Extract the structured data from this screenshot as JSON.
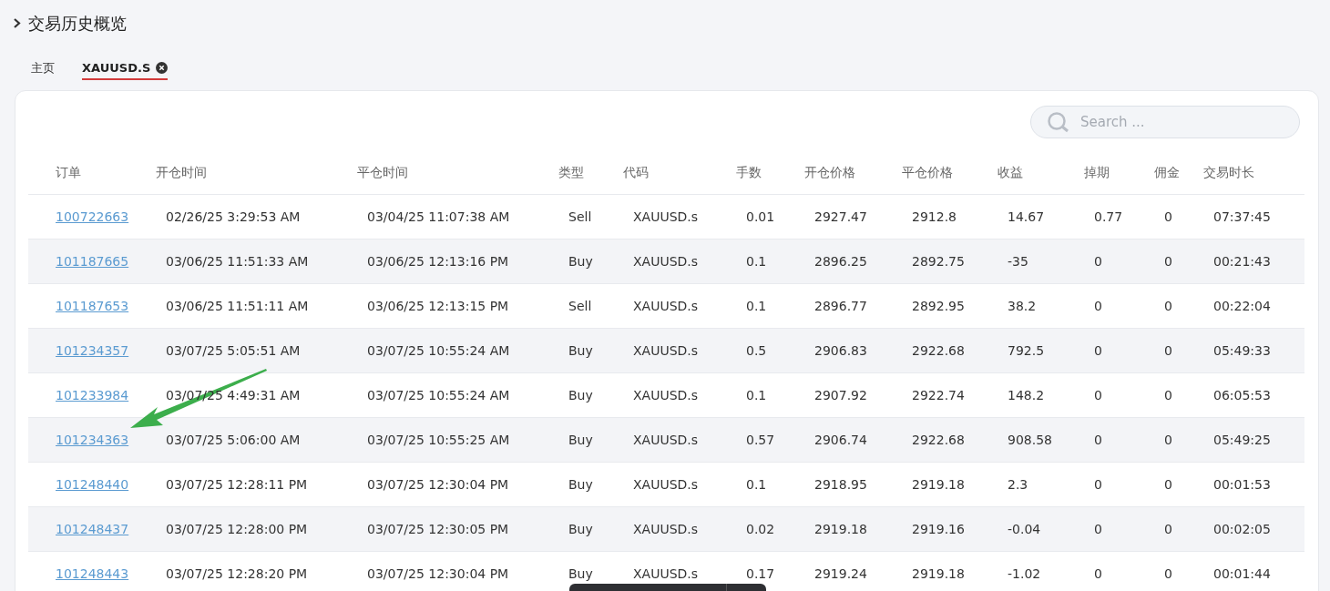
{
  "section": {
    "title": "交易历史概览"
  },
  "tabs": [
    {
      "label": "主页",
      "selected": false,
      "closable": false
    },
    {
      "label": "XAUUSD.S",
      "selected": true,
      "closable": true
    }
  ],
  "search": {
    "placeholder": "Search ..."
  },
  "table": {
    "columns": [
      "订单",
      "开仓时间",
      "平仓时间",
      "类型",
      "代码",
      "手数",
      "开仓价格",
      "平仓价格",
      "收益",
      "掉期",
      "佣金",
      "交易时长"
    ],
    "rows": [
      [
        "100722663",
        "02/26/25 3:29:53 AM",
        "03/04/25 11:07:38 AM",
        "Sell",
        "XAUUSD.s",
        "0.01",
        "2927.47",
        "2912.8",
        "14.67",
        "0.77",
        "0",
        "07:37:45"
      ],
      [
        "101187665",
        "03/06/25 11:51:33 AM",
        "03/06/25 12:13:16 PM",
        "Buy",
        "XAUUSD.s",
        "0.1",
        "2896.25",
        "2892.75",
        "-35",
        "0",
        "0",
        "00:21:43"
      ],
      [
        "101187653",
        "03/06/25 11:51:11 AM",
        "03/06/25 12:13:15 PM",
        "Sell",
        "XAUUSD.s",
        "0.1",
        "2896.77",
        "2892.95",
        "38.2",
        "0",
        "0",
        "00:22:04"
      ],
      [
        "101234357",
        "03/07/25 5:05:51 AM",
        "03/07/25 10:55:24 AM",
        "Buy",
        "XAUUSD.s",
        "0.5",
        "2906.83",
        "2922.68",
        "792.5",
        "0",
        "0",
        "05:49:33"
      ],
      [
        "101233984",
        "03/07/25 4:49:31 AM",
        "03/07/25 10:55:24 AM",
        "Buy",
        "XAUUSD.s",
        "0.1",
        "2907.92",
        "2922.74",
        "148.2",
        "0",
        "0",
        "06:05:53"
      ],
      [
        "101234363",
        "03/07/25 5:06:00 AM",
        "03/07/25 10:55:25 AM",
        "Buy",
        "XAUUSD.s",
        "0.57",
        "2906.74",
        "2922.68",
        "908.58",
        "0",
        "0",
        "05:49:25"
      ],
      [
        "101248440",
        "03/07/25 12:28:11 PM",
        "03/07/25 12:30:04 PM",
        "Buy",
        "XAUUSD.s",
        "0.1",
        "2918.95",
        "2919.18",
        "2.3",
        "0",
        "0",
        "00:01:53"
      ],
      [
        "101248437",
        "03/07/25 12:28:00 PM",
        "03/07/25 12:30:05 PM",
        "Buy",
        "XAUUSD.s",
        "0.02",
        "2919.18",
        "2919.16",
        "-0.04",
        "0",
        "0",
        "00:02:05"
      ],
      [
        "101248443",
        "03/07/25 12:28:20 PM",
        "03/07/25 12:30:04 PM",
        "Buy",
        "XAUUSD.s",
        "0.17",
        "2919.24",
        "2919.18",
        "-1.02",
        "0",
        "0",
        "00:01:44"
      ]
    ]
  }
}
